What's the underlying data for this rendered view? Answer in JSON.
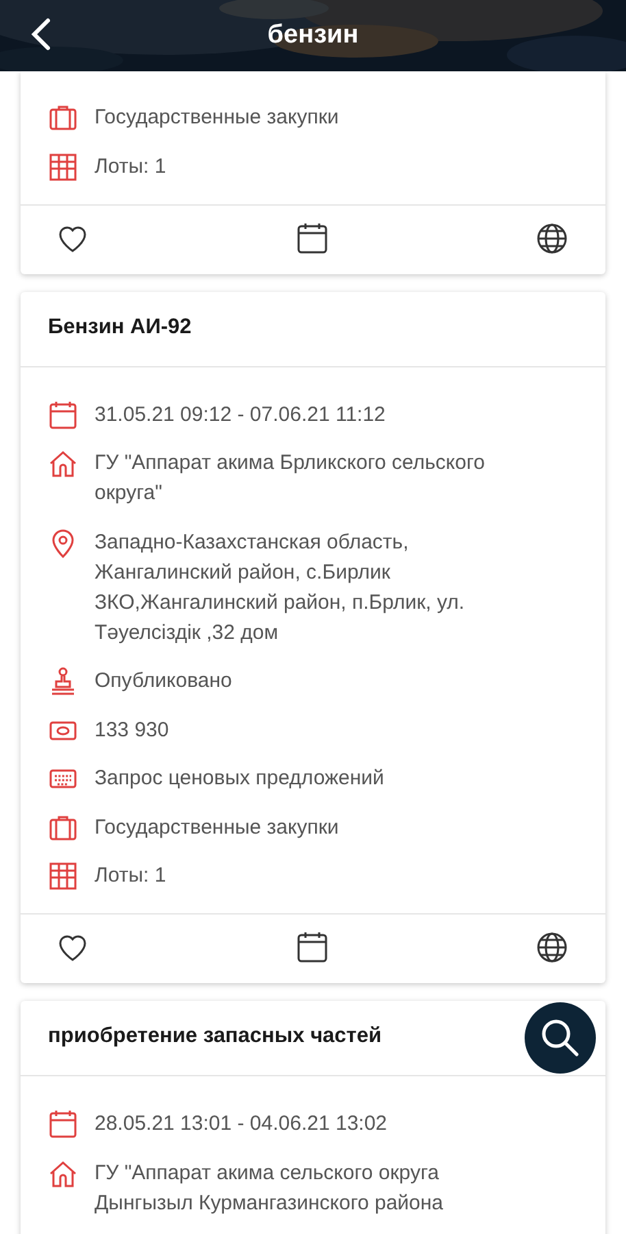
{
  "header": {
    "title": "бензин"
  },
  "cards": [
    {
      "rows": [
        {
          "kind": "briefcase",
          "text": "Государственные закупки"
        },
        {
          "kind": "lots",
          "text": "Лоты: 1"
        }
      ]
    },
    {
      "title": "Бензин АИ-92",
      "rows": [
        {
          "kind": "calendar",
          "text": "31.05.21 09:12 - 07.06.21 11:12"
        },
        {
          "kind": "house",
          "text": "ГУ \"Аппарат акима Брликского сельского округа\""
        },
        {
          "kind": "pin",
          "text": "Западно-Казахстанская область, Жангалинский район, с.Бирлик ЗКО,Жангалинский район, п.Брлик, ул. Тәуелсіздік ,32 дом"
        },
        {
          "kind": "stamp",
          "text": "Опубликовано"
        },
        {
          "kind": "money",
          "text": "133 930"
        },
        {
          "kind": "keyboard",
          "text": "Запрос ценовых предложений"
        },
        {
          "kind": "briefcase",
          "text": "Государственные закупки"
        },
        {
          "kind": "lots",
          "text": "Лоты: 1"
        }
      ]
    },
    {
      "title": "приобретение запасных частей",
      "rows": [
        {
          "kind": "calendar",
          "text": "28.05.21 13:01 - 04.06.21 13:02"
        },
        {
          "kind": "house",
          "text": "ГУ \"Аппарат акима сельского округа Дынгызыл Курмангазинского района"
        }
      ]
    }
  ]
}
